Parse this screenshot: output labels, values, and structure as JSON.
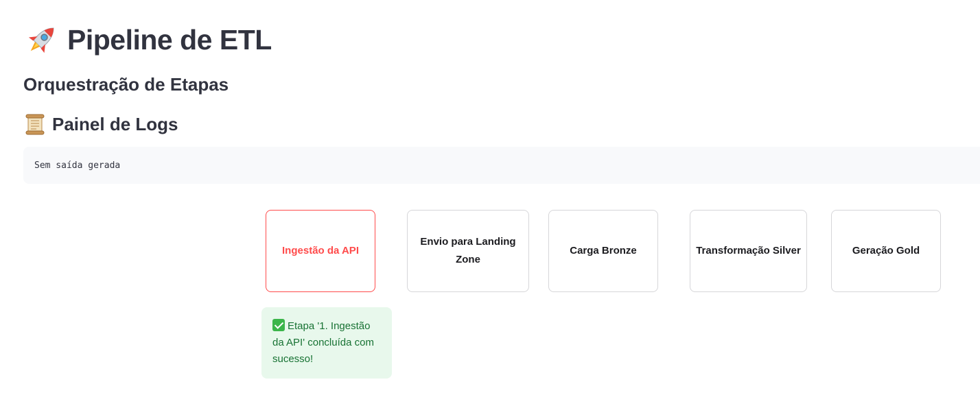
{
  "header": {
    "title": "Pipeline de ETL",
    "title_icon": "rocket-icon"
  },
  "subtitle": "Orquestração de Etapas",
  "logs": {
    "title": "Painel de Logs",
    "title_icon": "scroll-icon",
    "output": "Sem saída gerada"
  },
  "steps": [
    {
      "label": "Ingestão da API",
      "active": true
    },
    {
      "label": "Envio para Landing Zone",
      "active": false
    },
    {
      "label": "Carga Bronze",
      "active": false
    },
    {
      "label": "Transformação Silver",
      "active": false
    },
    {
      "label": "Geração Gold",
      "active": false
    }
  ],
  "success_message": "Etapa '1. Ingestão da API' concluída com sucesso!",
  "colors": {
    "accent": "#ff4b4b",
    "success_bg": "#e8f8ec",
    "success_text": "#177233",
    "text": "#31333f"
  }
}
